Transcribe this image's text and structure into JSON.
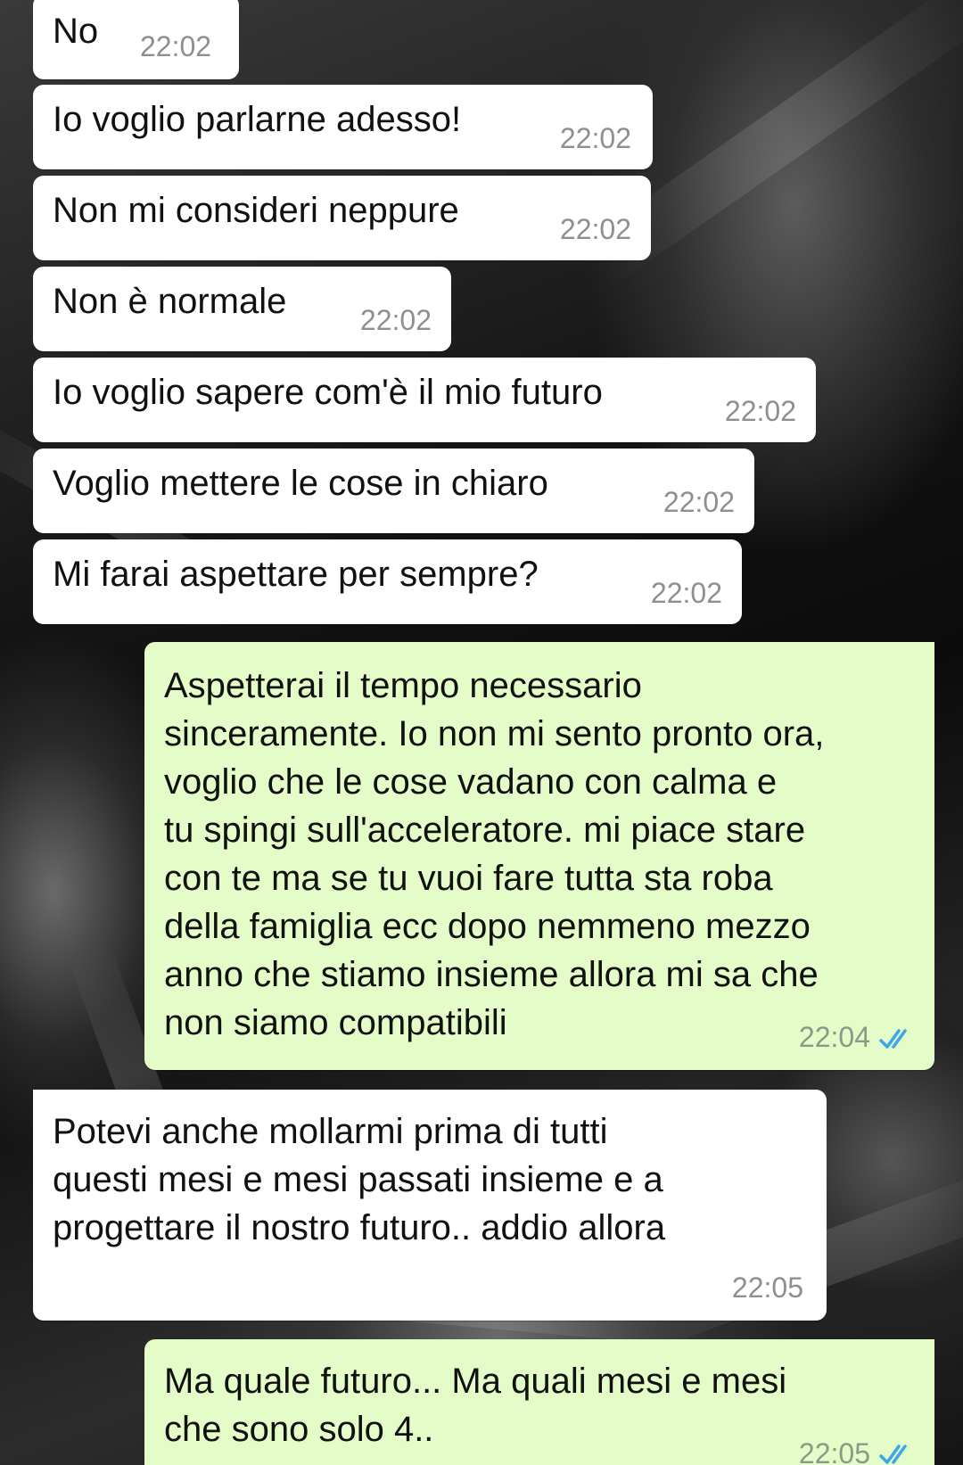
{
  "colors": {
    "incoming_bubble": "#ffffff",
    "outgoing_bubble": "#e4fdc8",
    "timestamp": "#8f8f8f",
    "read_ticks": "#3aa6e8"
  },
  "icons": {
    "read_receipt": "double-check-icon"
  },
  "messages": [
    {
      "direction": "in",
      "text": "No",
      "time": "22:02"
    },
    {
      "direction": "in",
      "text": "Io voglio parlarne adesso!",
      "time": "22:02"
    },
    {
      "direction": "in",
      "text": "Non mi consideri neppure",
      "time": "22:02"
    },
    {
      "direction": "in",
      "text": "Non è normale",
      "time": "22:02"
    },
    {
      "direction": "in",
      "text": "Io voglio sapere com'è il mio futuro",
      "time": "22:02"
    },
    {
      "direction": "in",
      "text": "Voglio mettere le cose in chiaro",
      "time": "22:02"
    },
    {
      "direction": "in",
      "text": "Mi farai aspettare per sempre?",
      "time": "22:02"
    },
    {
      "direction": "out",
      "text": "Aspetterai il tempo necessario\nsinceramente. Io non mi sento pronto ora,\nvoglio che le cose vadano con calma e\ntu spingi sull'acceleratore. mi piace stare\ncon te ma se tu vuoi fare tutta sta roba\ndella famiglia ecc dopo nemmeno mezzo\nanno che stiamo insieme allora mi sa che\nnon siamo compatibili",
      "time": "22:04",
      "status": "read"
    },
    {
      "direction": "in",
      "text": "Potevi anche mollarmi prima di tutti\nquesti mesi e mesi passati insieme e a\nprogettare il nostro futuro.. addio allora",
      "time": "22:05"
    },
    {
      "direction": "out",
      "text": "Ma quale futuro... Ma quali mesi e mesi\nche sono solo 4..",
      "time": "22:05",
      "status": "read"
    }
  ]
}
